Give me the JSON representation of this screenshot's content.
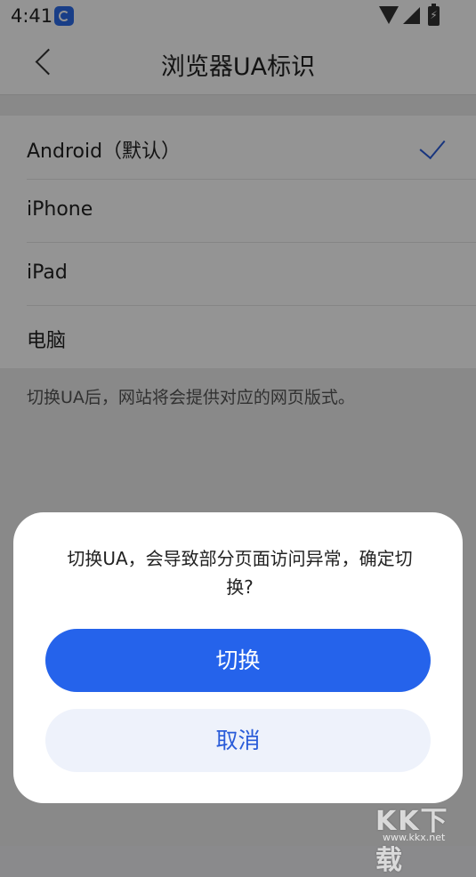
{
  "status_bar": {
    "time": "4:41"
  },
  "app_bar": {
    "title": "浏览器UA标识"
  },
  "options": [
    {
      "label": "Android（默认）",
      "selected": true
    },
    {
      "label": "iPhone",
      "selected": false
    },
    {
      "label": "iPad",
      "selected": false
    },
    {
      "label": "电脑",
      "selected": false
    }
  ],
  "hint": "切换UA后，网站将会提供对应的网页版式。",
  "dialog": {
    "message": "切换UA，会导致部分页面访问异常，确定切换?",
    "confirm_label": "切换",
    "cancel_label": "取消"
  },
  "watermark": {
    "main": "KK下载",
    "sub": "www.kkx.net"
  },
  "colors": {
    "accent": "#2563eb",
    "cancel_bg": "#eef2fb"
  }
}
